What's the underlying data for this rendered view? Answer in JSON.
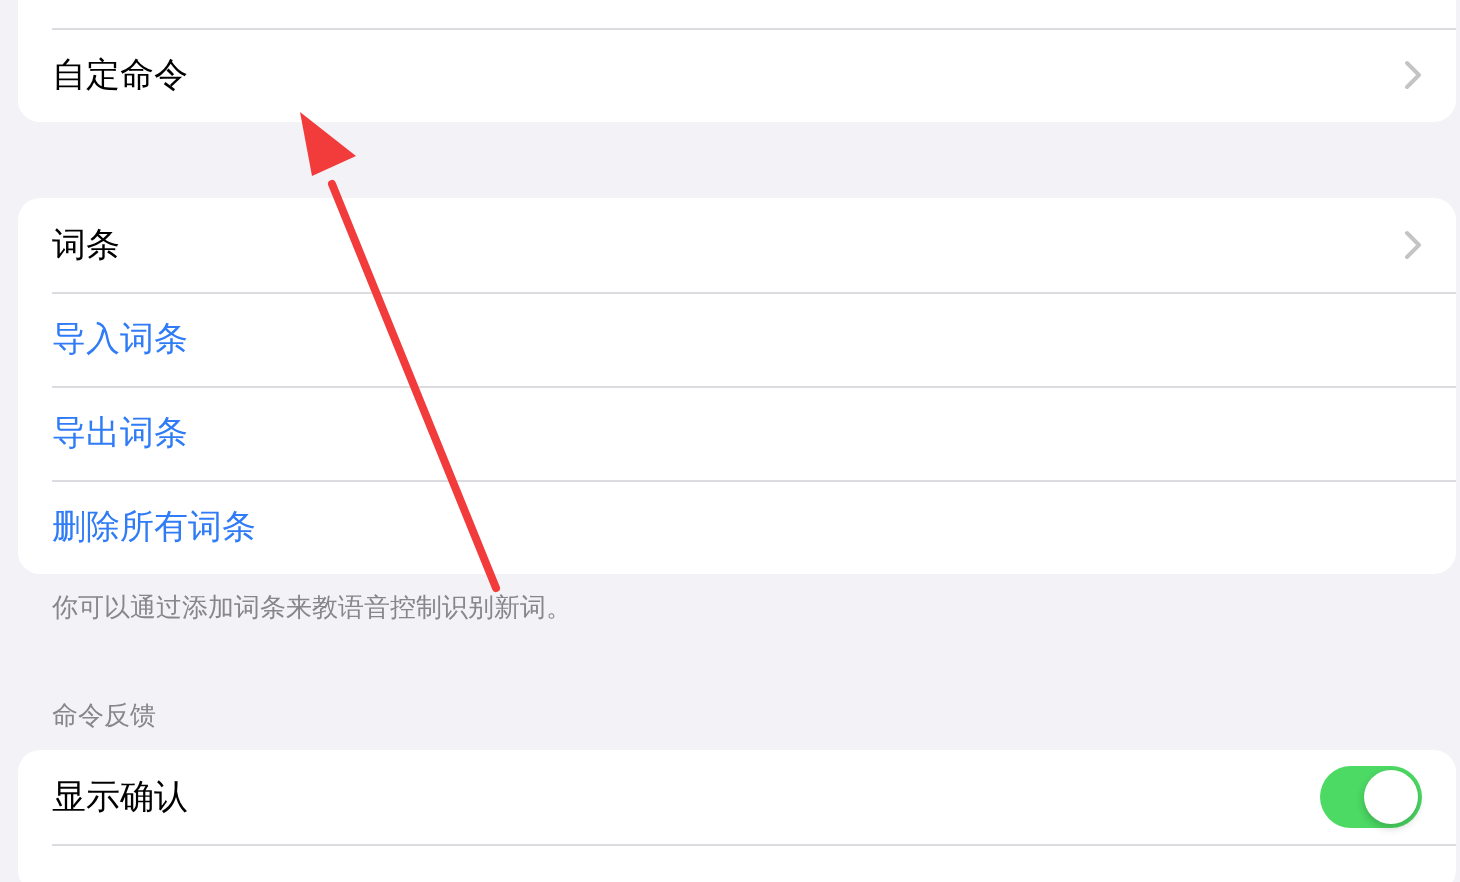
{
  "groups": [
    {
      "rows": [
        {
          "kind": "cut"
        },
        {
          "kind": "nav",
          "label": "自定命令"
        }
      ]
    },
    {
      "rows": [
        {
          "kind": "nav",
          "label": "词条"
        },
        {
          "kind": "action",
          "label": "导入词条"
        },
        {
          "kind": "action",
          "label": "导出词条"
        },
        {
          "kind": "action",
          "label": "删除所有词条"
        }
      ],
      "footer": "你可以通过添加词条来教语音控制识别新词。"
    },
    {
      "header": "命令反馈",
      "rows": [
        {
          "kind": "toggle",
          "label": "显示确认",
          "on": true
        },
        {
          "kind": "cut"
        }
      ]
    }
  ],
  "annotation": {
    "kind": "arrow"
  }
}
